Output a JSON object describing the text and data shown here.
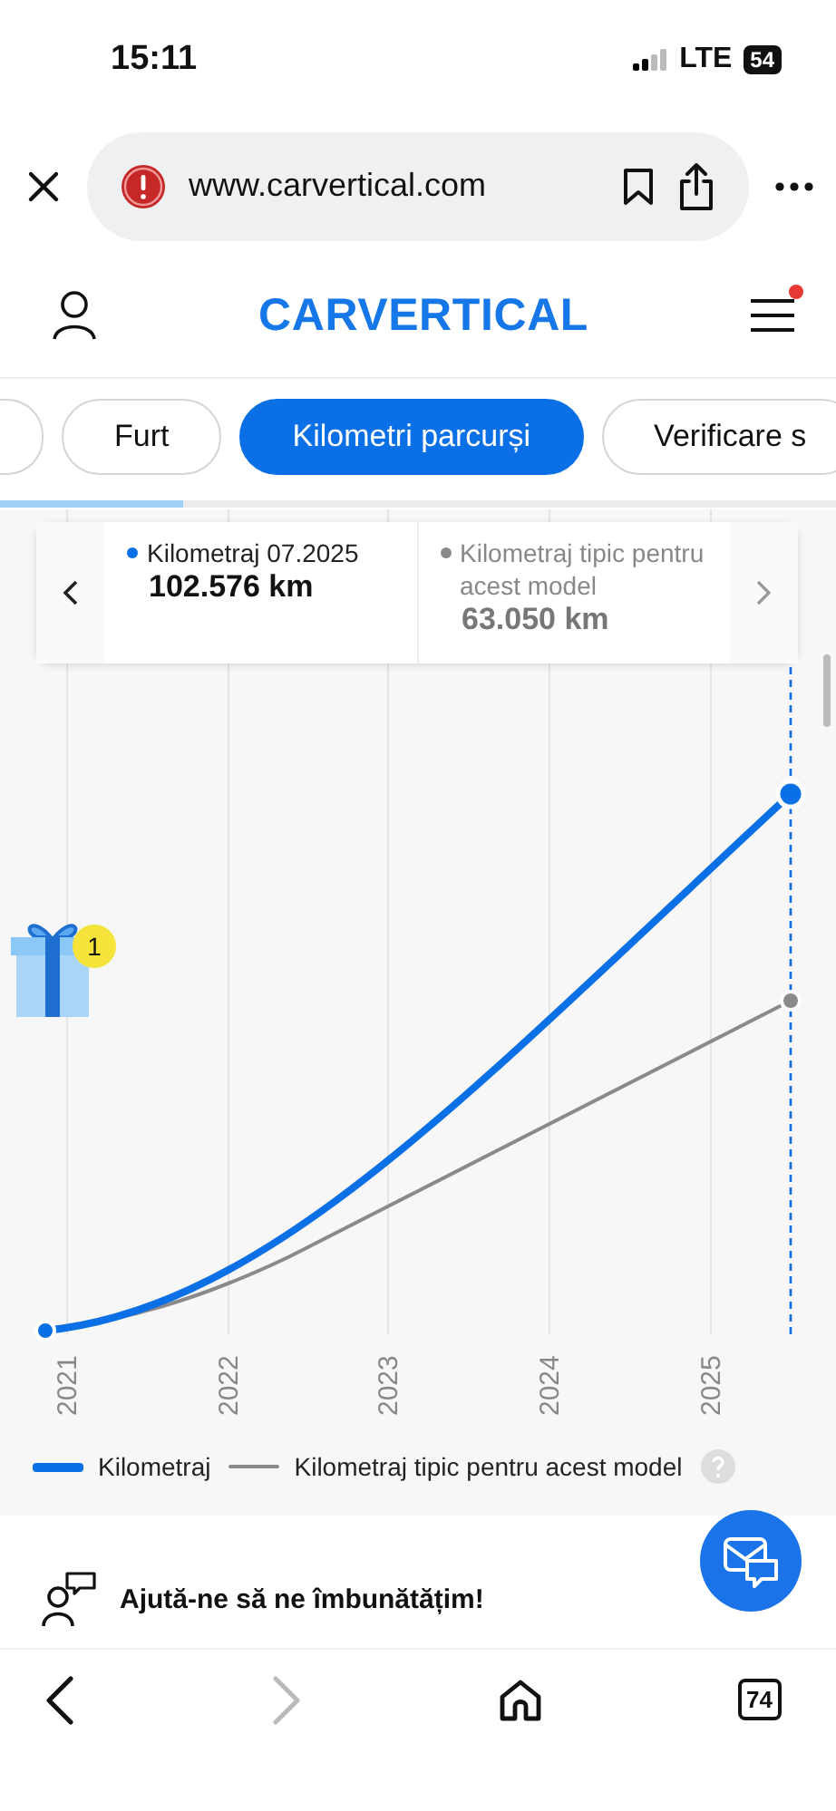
{
  "status_bar": {
    "time": "15:11",
    "network": "LTE",
    "battery": "54"
  },
  "browser": {
    "url": "www.carvertical.com",
    "forward_disabled": true,
    "tab_count": "74"
  },
  "header": {
    "logo": "CARVERTICAL",
    "menu_notification": true
  },
  "tabs": [
    {
      "label": "Furt",
      "selected": false
    },
    {
      "label": "Kilometri parcurși",
      "selected": true
    },
    {
      "label": "Verificare s",
      "selected": false
    }
  ],
  "scroll_progress": {
    "level": 0.22
  },
  "tooltip": {
    "series": [
      {
        "label": "Kilometraj 07.2025",
        "value": "102.576 km",
        "color": "#0b6fe6"
      },
      {
        "label": "Kilometraj tipic pentru acest model",
        "value": "63.050 km",
        "color": "#8a8a8a"
      }
    ]
  },
  "gift": {
    "badge": "1"
  },
  "chart": {
    "x_labels": [
      "2021",
      "2022",
      "2023",
      "2024",
      "2025"
    ],
    "legend": [
      {
        "label": "Kilometraj",
        "color": "#0b6fe6"
      },
      {
        "label": "Kilometraj tipic pentru acest model",
        "color": "#8a8a8a"
      }
    ]
  },
  "feedback": {
    "title": "Ajută-ne să ne îmbunătățim!"
  }
}
